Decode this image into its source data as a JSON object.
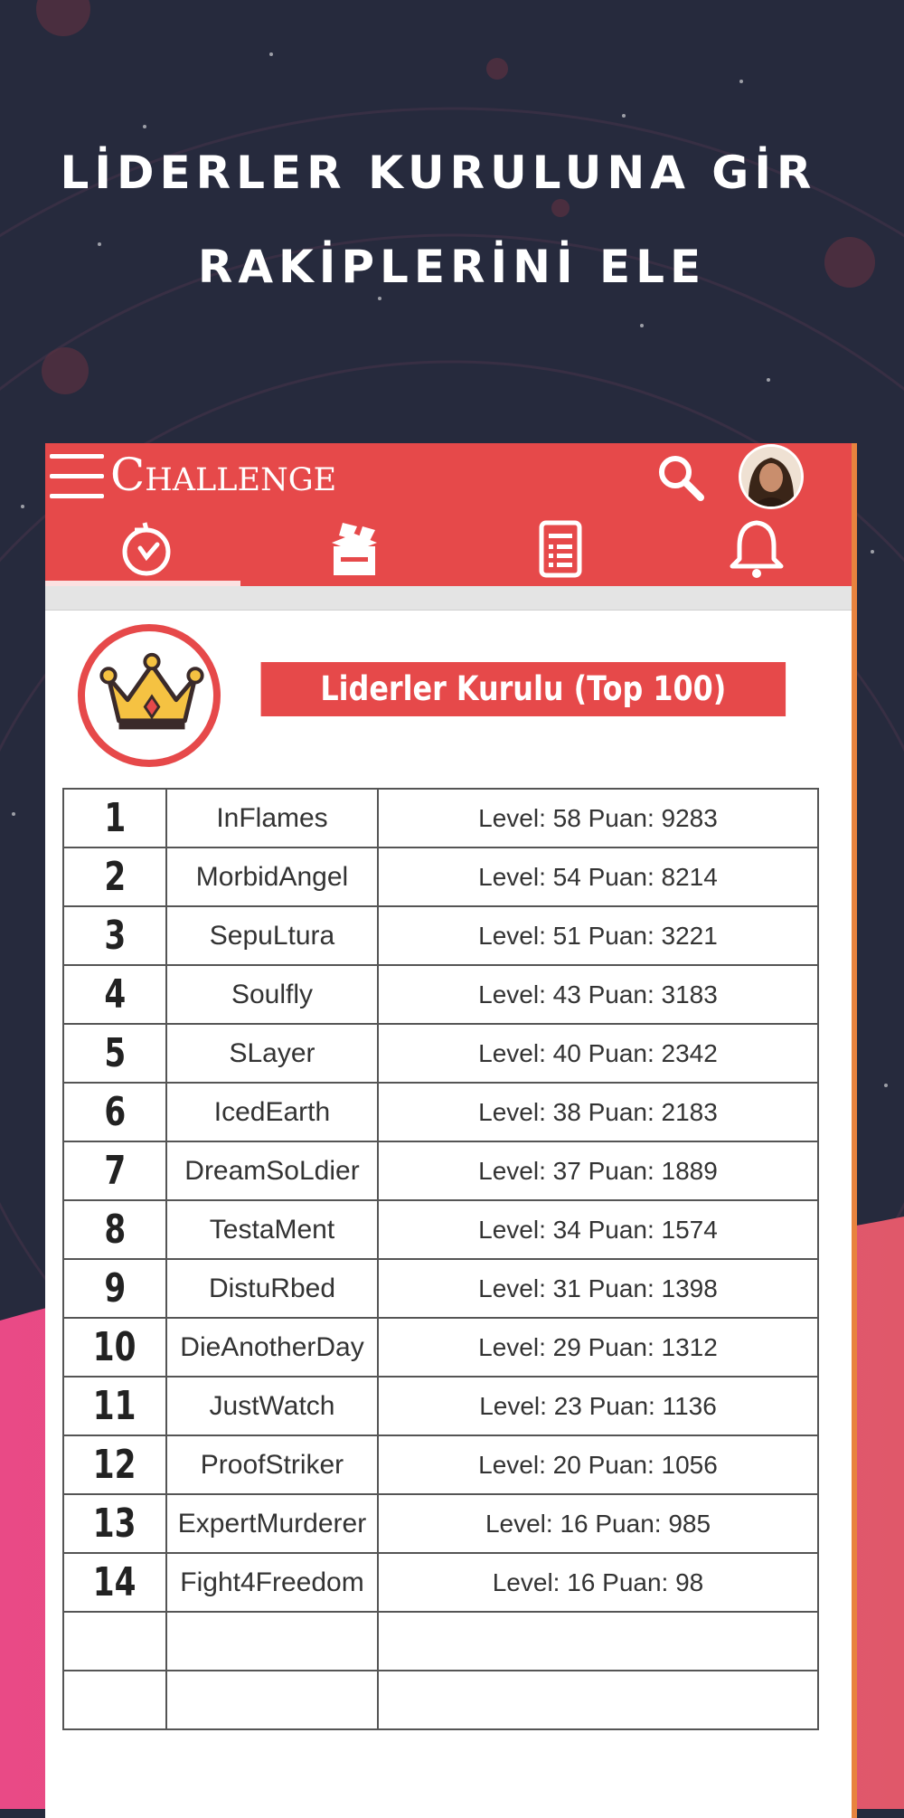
{
  "promo": {
    "line1": "LİDERLER KURULUNA GİR",
    "line2": "RAKİPLERİNİ ELE"
  },
  "app": {
    "title": "Challenge",
    "brand_color": "#e6494a",
    "accent_color": "#e8833e"
  },
  "header": {
    "menu_icon": "hamburger-menu-icon",
    "search_icon": "search-icon",
    "avatar": "user-avatar",
    "tabs": [
      {
        "icon": "timer-icon",
        "active": true
      },
      {
        "icon": "box-icon",
        "active": false
      },
      {
        "icon": "document-list-icon",
        "active": false
      },
      {
        "icon": "bell-icon",
        "active": false
      }
    ]
  },
  "leaderboard": {
    "title": "Liderler Kurulu (Top 100)",
    "icon": "crown-icon",
    "rows": [
      {
        "rank": "1",
        "name": "InFlames",
        "stats": "Level: 58 Puan: 9283"
      },
      {
        "rank": "2",
        "name": "MorbidAngel",
        "stats": "Level: 54 Puan: 8214"
      },
      {
        "rank": "3",
        "name": "SepuLtura",
        "stats": "Level: 51 Puan: 3221"
      },
      {
        "rank": "4",
        "name": "Soulfly",
        "stats": "Level: 43 Puan: 3183"
      },
      {
        "rank": "5",
        "name": "SLayer",
        "stats": "Level: 40 Puan: 2342"
      },
      {
        "rank": "6",
        "name": "IcedEarth",
        "stats": "Level: 38 Puan: 2183"
      },
      {
        "rank": "7",
        "name": "DreamSoLdier",
        "stats": "Level: 37 Puan: 1889"
      },
      {
        "rank": "8",
        "name": "TestaMent",
        "stats": "Level: 34 Puan: 1574"
      },
      {
        "rank": "9",
        "name": "DistuRbed",
        "stats": "Level: 31 Puan: 1398"
      },
      {
        "rank": "10",
        "name": "DieAnotherDay",
        "stats": "Level: 29 Puan: 1312"
      },
      {
        "rank": "11",
        "name": "JustWatch",
        "stats": "Level: 23 Puan: 1136"
      },
      {
        "rank": "12",
        "name": "ProofStriker",
        "stats": "Level: 20 Puan: 1056"
      },
      {
        "rank": "13",
        "name": "ExpertMurderer",
        "stats": "Level: 16 Puan: 985"
      },
      {
        "rank": "14",
        "name": "Fight4Freedom",
        "stats": "Level: 16 Puan: 98"
      },
      {
        "rank": "",
        "name": "",
        "stats": ""
      },
      {
        "rank": "",
        "name": "",
        "stats": ""
      }
    ]
  }
}
